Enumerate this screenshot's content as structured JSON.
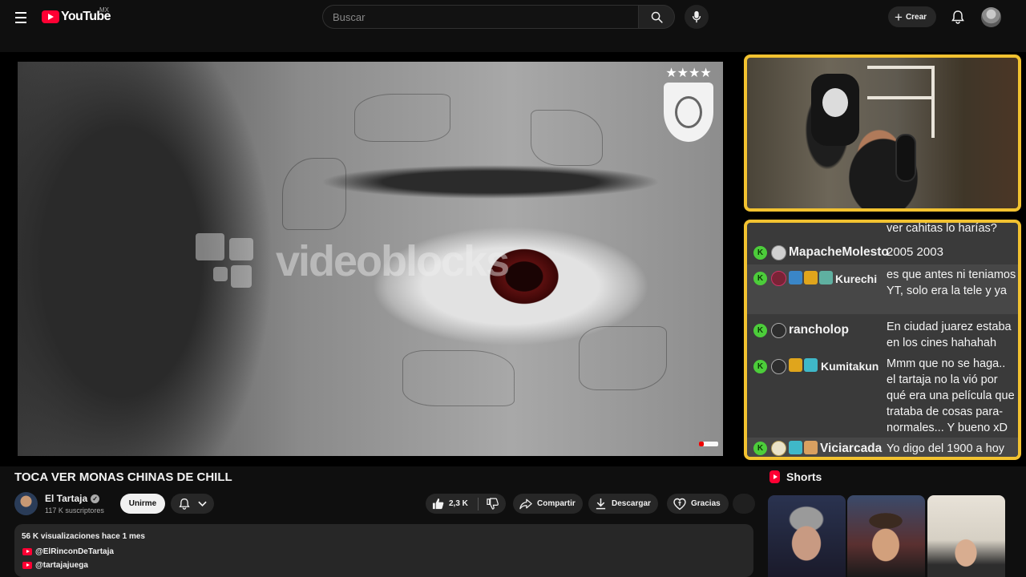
{
  "header": {
    "logo_text": "YouTube",
    "region": "MX",
    "search_placeholder": "Buscar",
    "create_label": "Crear",
    "icons": [
      "menu-icon",
      "search-icon",
      "mic-icon",
      "plus-icon",
      "bell-icon"
    ]
  },
  "video": {
    "watermark_text": "videoblocks",
    "title": "TOCA VER MONAS CHINAS DE CHILL"
  },
  "chat": {
    "partial_top": "ver cahitas lo harías?",
    "messages": [
      {
        "user": "MapacheMolesto",
        "text": "2005 2003"
      },
      {
        "user": "Kurechi",
        "text": "es que antes ni teniamos YT, solo era la tele y ya"
      },
      {
        "user": "rancholop",
        "text": "En ciudad juarez estaba en los cines hahahah"
      },
      {
        "user": "Kumitakun",
        "text": "Mmm que no se haga.. el tartaja no la vió por qué era una película que trataba de cosas para-normales... Y bueno xD"
      },
      {
        "user": "Viciarcada",
        "text": "Yo digo del 1900 a hoy"
      }
    ],
    "badge_letter": "K"
  },
  "channel": {
    "name": "El Tartaja",
    "subscribers": "117 K suscriptores",
    "join_label": "Unirme"
  },
  "actions": {
    "likes": "2,3 K",
    "share_label": "Compartir",
    "download_label": "Descargar",
    "thanks_label": "Gracias"
  },
  "description": {
    "meta": "56 K visualizaciones  hace 1 mes",
    "links": [
      "@ElRinconDeTartaja",
      "@tartajajuega"
    ]
  },
  "shorts": {
    "heading": "Shorts"
  },
  "colors": {
    "accent_red": "#ff0033",
    "frame_yellow": "#f2c230",
    "chat_badge_green": "#4ccd3a",
    "background": "#0f0f0f"
  }
}
